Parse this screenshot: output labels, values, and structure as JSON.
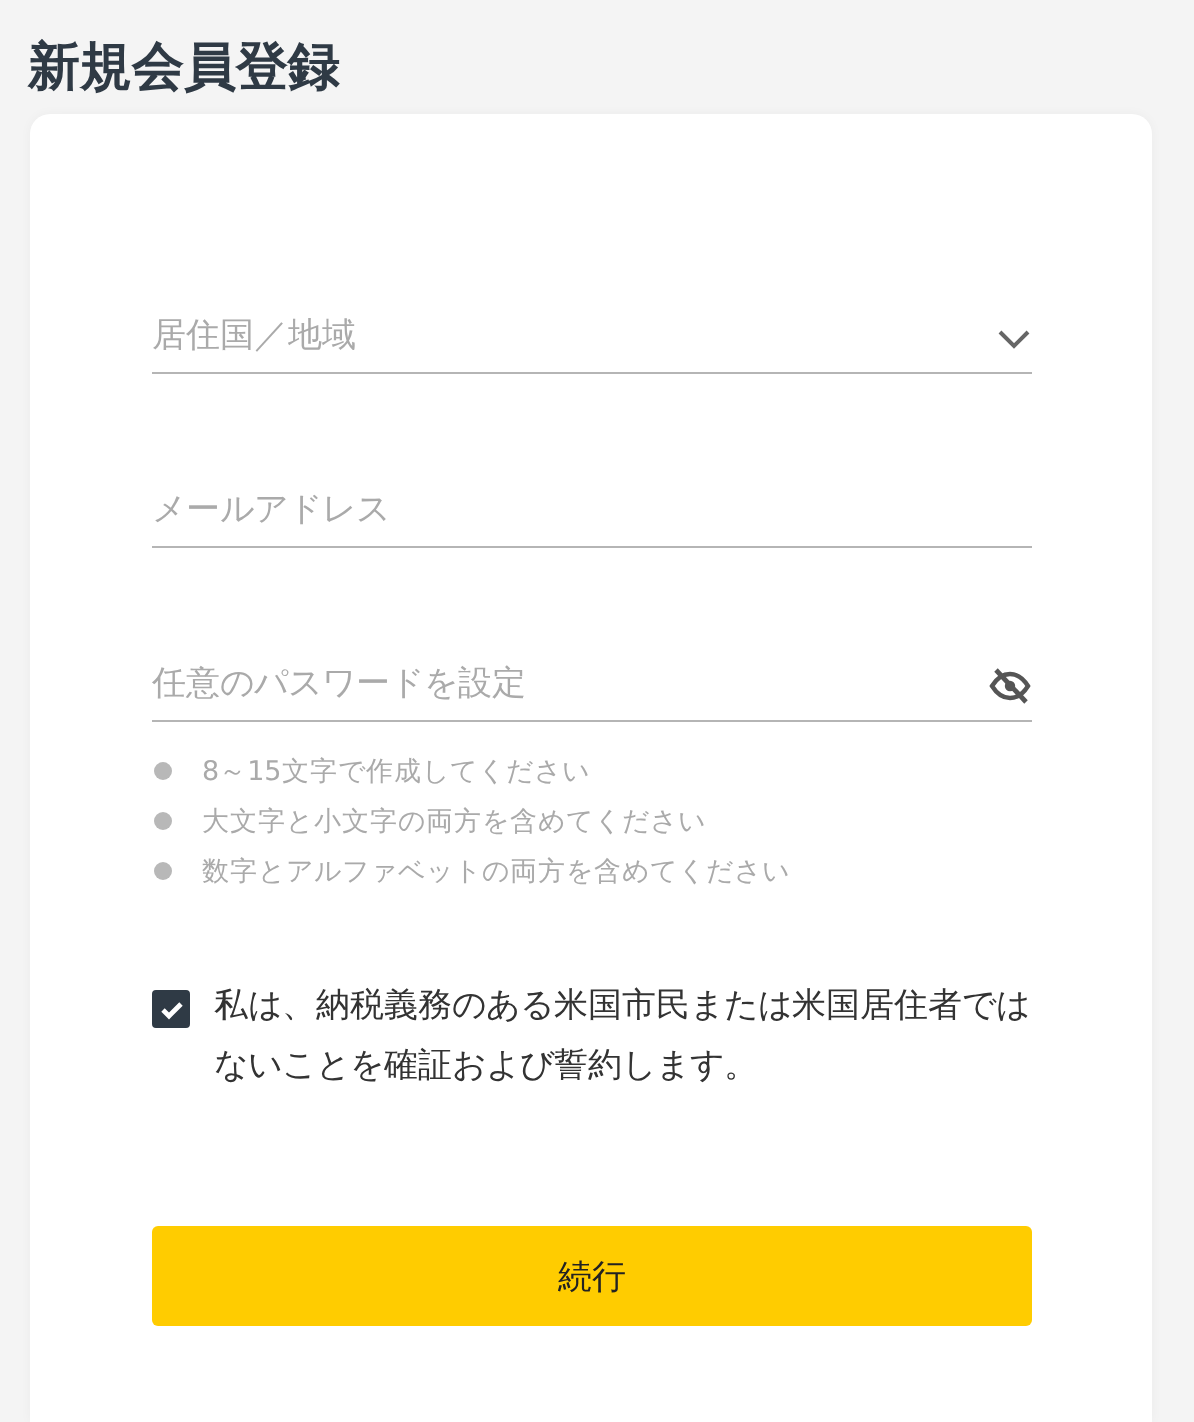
{
  "title": "新規会員登録",
  "fields": [
    {
      "kind": "select",
      "placeholder": "居住国／地域"
    },
    {
      "kind": "text",
      "placeholder": "メールアドレス"
    },
    {
      "kind": "password",
      "placeholder": "任意のパスワードを設定"
    }
  ],
  "password_rules": [
    "8～15文字で作成してください",
    "大文字と小文字の両方を含めてください",
    "数字とアルファベットの両方を含めてください"
  ],
  "agreement": {
    "checked": true,
    "label": "私は、納税義務のある米国市民または米国居住者ではないことを確証および誓約します。"
  },
  "submit": "続行"
}
